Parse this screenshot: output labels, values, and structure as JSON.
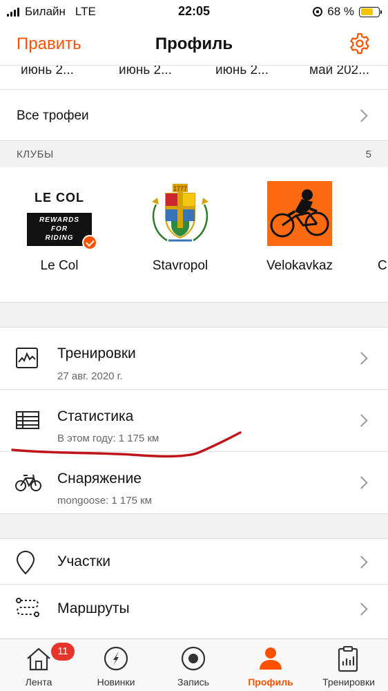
{
  "status_bar": {
    "carrier": "Билайн",
    "network": "LTE",
    "time": "22:05",
    "battery_percent": "68 %",
    "battery_level": 0.68
  },
  "navbar": {
    "edit_label": "Править",
    "title": "Профиль",
    "settings_icon": "gear-icon"
  },
  "trophy_dates": [
    "июнь 2...",
    "июнь 2...",
    "июнь 2...",
    "май 202..."
  ],
  "all_trophies_label": "Все трофеи",
  "clubs": {
    "header": "КЛУБЫ",
    "count": "5",
    "items": [
      {
        "name": "Le Col",
        "logo_text_top": "LE COL",
        "logo_text_box": [
          "REWARDS",
          "FOR",
          "RIDING"
        ],
        "verified": true
      },
      {
        "name": "Stavropol",
        "logo_text_top": "1777"
      },
      {
        "name": "Velokavkaz"
      },
      {
        "name": "C"
      }
    ]
  },
  "menu_primary": [
    {
      "title": "Тренировки",
      "subtitle": "27 авг. 2020 г.",
      "icon": "activity-chart-icon"
    },
    {
      "title": "Статистика",
      "subtitle": "В этом году: 1 175 км",
      "icon": "stats-table-icon"
    },
    {
      "title": "Снаряжение",
      "subtitle": "mongoose: 1 175 км",
      "icon": "bicycle-icon"
    }
  ],
  "menu_secondary": [
    {
      "title": "Участки",
      "icon": "location-pin-icon"
    },
    {
      "title": "Маршруты",
      "icon": "route-icon"
    }
  ],
  "tabbar": {
    "items": [
      {
        "label": "Лента",
        "icon": "home-icon",
        "badge": "11"
      },
      {
        "label": "Новинки",
        "icon": "compass-icon"
      },
      {
        "label": "Запись",
        "icon": "record-icon"
      },
      {
        "label": "Профиль",
        "icon": "profile-icon",
        "active": true
      },
      {
        "label": "Тренировки",
        "icon": "clipboard-icon"
      }
    ]
  },
  "colors": {
    "accent": "#fc5200",
    "badge": "#e8352b",
    "annotation_stroke": "#c0141b",
    "battery": "#f5c400"
  }
}
